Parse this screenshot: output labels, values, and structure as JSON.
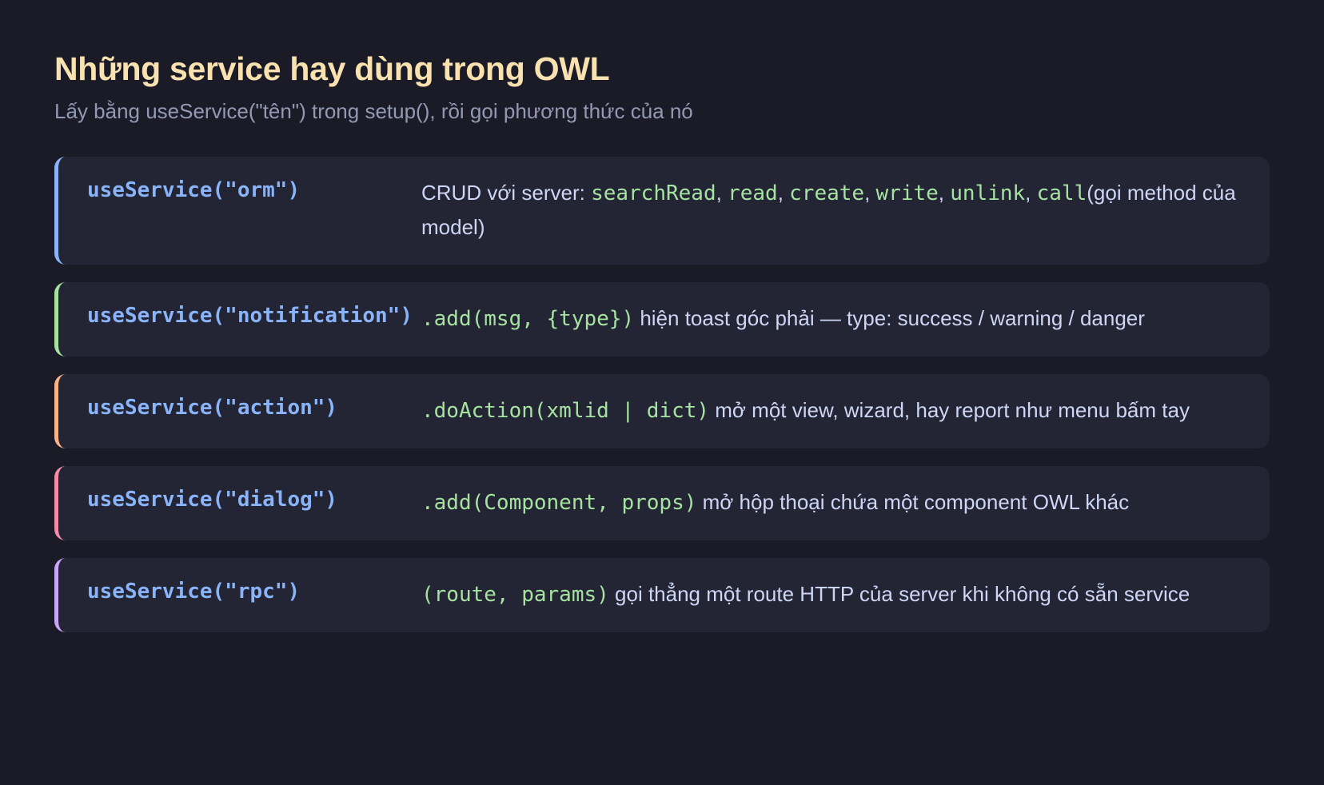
{
  "title": "Những service hay dùng trong OWL",
  "subtitle": "Lấy bằng useService(\"tên\") trong setup(), rồi gọi phương thức của nó",
  "colors": {
    "background": "#1a1b26",
    "card": "#232434",
    "title": "#f9e2af",
    "subtitle": "#9399b2",
    "service_name": "#89b4fa",
    "code": "#a6e3a1",
    "text": "#cdd6f4",
    "accents": [
      "#89b4fa",
      "#a6e3a1",
      "#fab387",
      "#f38ba8",
      "#cba6f7"
    ]
  },
  "services": [
    {
      "name": "useService(\"orm\")",
      "desc_prefix": "CRUD với server: ",
      "methods": [
        "searchRead",
        "read",
        "create",
        "write",
        "unlink",
        "call"
      ],
      "sep": ", ",
      "desc_suffix": "(gọi method của model)"
    },
    {
      "name": "useService(\"notification\")",
      "code": ".add(msg, {type})",
      "text": " hiện toast góc phải — type: success / warning / danger"
    },
    {
      "name": "useService(\"action\")",
      "code": ".doAction(xmlid | dict)",
      "text": " mở một view, wizard, hay report như menu bấm tay"
    },
    {
      "name": "useService(\"dialog\")",
      "code": ".add(Component, props)",
      "text": " mở hộp thoại chứa một component OWL khác"
    },
    {
      "name": "useService(\"rpc\")",
      "code": "(route, params)",
      "text": " gọi thẳng một route HTTP của server khi không có sẵn service"
    }
  ]
}
